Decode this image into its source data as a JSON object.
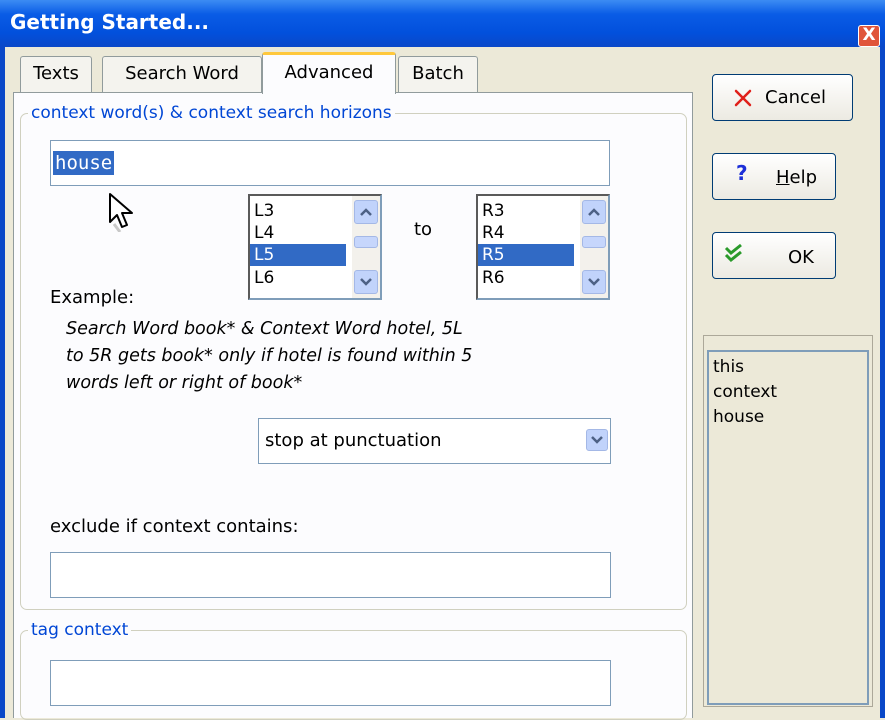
{
  "window": {
    "title": "Getting Started...",
    "close_label": "X"
  },
  "tabs": [
    {
      "label": "Texts"
    },
    {
      "label": "Search Word"
    },
    {
      "label": "Advanced"
    },
    {
      "label": "Batch"
    }
  ],
  "context_group": {
    "legend": "context word(s) & context search horizons",
    "context_word_value": "house",
    "left_list": {
      "items": [
        "L3",
        "L4",
        "L5",
        "L6"
      ],
      "selected": "L5"
    },
    "to_label": "to",
    "right_list": {
      "items": [
        "R3",
        "R4",
        "R5",
        "R6"
      ],
      "selected": "R5"
    },
    "example_label": "Example:",
    "example_text": "Search Word book* & Context Word hotel, 5L to 5R gets book* only if hotel is found within 5 words left or right of book*",
    "example_lines": [
      "Search Word book* & Context Word hotel, 5L",
      "to 5R gets book* only if hotel is found within 5",
      "words left or right of book*"
    ],
    "punctuation_select": "stop at punctuation",
    "exclude_label": "exclude if context contains:",
    "exclude_value": ""
  },
  "tag_group": {
    "legend": "tag context",
    "value": ""
  },
  "buttons": {
    "cancel": "Cancel",
    "help": "Help",
    "help_mnemonic": "H",
    "help_rest": "elp",
    "ok": "OK"
  },
  "context_words_list": [
    "this",
    "context",
    "house"
  ],
  "colors": {
    "accent": "#0046d5",
    "selection": "#316ac5",
    "titlebar": "#0a5ce6",
    "tab_highlight": "#ffc83c"
  }
}
